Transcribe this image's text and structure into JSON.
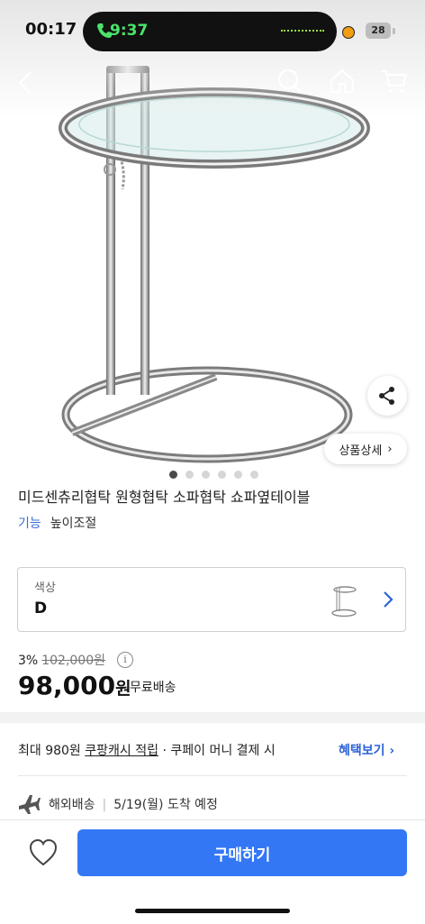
{
  "status_bar": {
    "time": "00:17",
    "island_time": "9:37",
    "battery": "28"
  },
  "nav": {
    "back_icon": "chevron-left-icon",
    "search_icon": "search-icon",
    "home_icon": "home-icon",
    "cart_icon": "cart-icon"
  },
  "hero": {
    "image": "chrome-glass-side-table",
    "share_icon": "share-icon",
    "detail_label": "상품상세",
    "dots_total": 6,
    "dots_active": 1
  },
  "product": {
    "title": "미드센츄리협탁 원형협탁 소파협탁 쇼파옆테이블",
    "feature_key": "기능",
    "feature_value": "높이조절"
  },
  "option": {
    "label": "색상",
    "value": "D"
  },
  "price": {
    "discount": "3%",
    "original": "102,000원",
    "amount": "98,000",
    "unit": "원",
    "shipping": "무료배송"
  },
  "cashback": {
    "prefix": "최대 980원",
    "link": "쿠팡캐시 적립",
    "suffix": "· 쿠페이 머니 결제 시",
    "benefit": "혜택보기 ›"
  },
  "delivery": {
    "type": "해외배송",
    "eta": "5/19(월) 도착 예정"
  },
  "bottom_bar": {
    "buy_label": "구매하기"
  },
  "colors": {
    "accent": "#3377f5",
    "link": "#2c64d6",
    "feature_key": "#3b6bd6"
  }
}
